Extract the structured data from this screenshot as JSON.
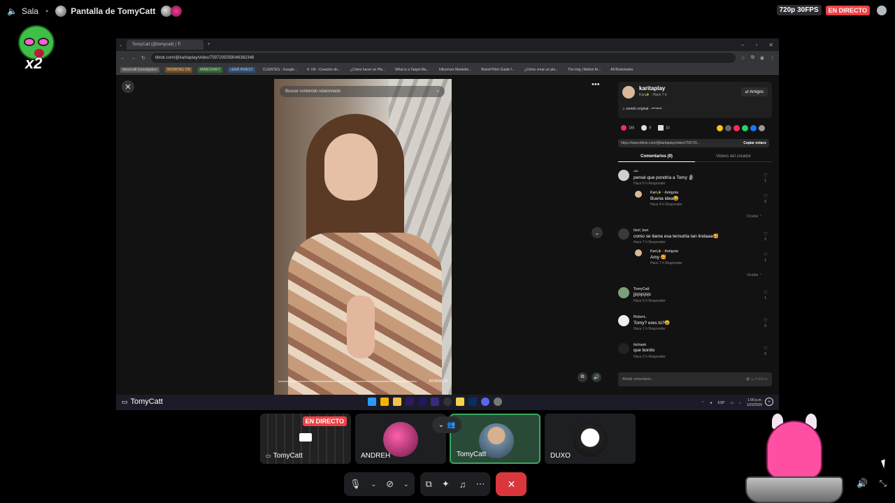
{
  "topbar": {
    "channel_label": "Sala",
    "stream_title": "Pantalla de TomyCatt",
    "quality": "720p 30FPS",
    "live_badge": "EN DIRECTO"
  },
  "mascot": {
    "multiplier": "x2"
  },
  "browser": {
    "tab_title": "TomyCatt (@tomycatt) | Ti",
    "url": "tiktok.com/@karitaplay/video/7597205059046362348",
    "bookmarks": [
      {
        "label": "minecraft investigation",
        "color": "#5a5a5a"
      },
      {
        "label": "WORKING ON",
        "color": "#7a4d1c"
      },
      {
        "label": "MINECRAFT",
        "color": "#2e6b2f"
      },
      {
        "label": "LEER INVEST",
        "color": "#2b4f7a"
      },
      {
        "label": "CLIENTES - Google..."
      },
      {
        "label": "4. I.M - Creación de..."
      },
      {
        "label": "¿Cómo hacer un Pla..."
      },
      {
        "label": "What is a Target Ma..."
      },
      {
        "label": "Influencer Marketin..."
      },
      {
        "label": "Brand Pitch Guide f..."
      },
      {
        "label": "¿Cómo crear un pla..."
      },
      {
        "label": "The img | Motion Ar..."
      },
      {
        "label": "All Bookmarks"
      }
    ]
  },
  "video": {
    "search_placeholder": "Buscar contenido relacionado",
    "time": "00:00/00:33"
  },
  "panel": {
    "username": "karitaplay",
    "user_meta": "Kari✨ · Hace 7 h",
    "friends_button": "⇄ Amigos",
    "sound": "♫ sonido original - ᵏᵃʳⁱᵗᵃᵖˡᵃʸ",
    "likes": "165",
    "comments_count": "9",
    "saves": "10",
    "link": "https://www.tiktok.com/@karitaplay/video/759720...",
    "copy_link": "Copiar enlace",
    "tab_comments": "Comentarios (9)",
    "tab_creator": "Videos del creador",
    "hide_label": "Ocultar ⌃",
    "add_comment_placeholder": "Añadir comentario...",
    "publish": "Publicar",
    "comments": [
      {
        "name": "ᵃᵈⁱᵃ",
        "text": "pensé que pondría a Tomy 🗿",
        "meta": "Hace 6 h    Responder",
        "likes": "1",
        "reply": false
      },
      {
        "name": "Kari✨ · Amigo/a",
        "text": "Buena idea😆",
        "meta": "Hace 4 h    Responder",
        "likes": "0",
        "reply": true
      },
      {
        "name": "itzel_kun",
        "text": "como se llama esa ternurita tan lindaaa🥰",
        "meta": "Hace 7 h    Responder",
        "likes": "2",
        "reply": false
      },
      {
        "name": "Kari✨ · Amigo/a",
        "text": "Amy 🥰",
        "meta": "Hace 7 h    Responder",
        "likes": "1",
        "reply": true
      },
      {
        "name": "TomyCatt",
        "text": "jjsjsjsjsjs",
        "meta": "Hace 5 h    Responder",
        "likes": "1",
        "reply": false
      },
      {
        "name": "Robert..",
        "text": "Tomy? eres tú?😆",
        "meta": "Hace 1 h    Responder",
        "likes": "0",
        "reply": false
      },
      {
        "name": "itsfrank",
        "text": "que bonito",
        "meta": "Hace 2 h    Responder",
        "likes": "0",
        "reply": false
      }
    ]
  },
  "taskbar": {
    "presenter": "TomyCatt",
    "lang": "ESP",
    "clock": "1:06 p.m.",
    "date": "1/20/2026"
  },
  "participants": [
    {
      "name": "TomyCatt",
      "live": "EN DIRECTO",
      "streaming": true
    },
    {
      "name": "ANDREH"
    },
    {
      "name": "TomyCatt",
      "selected": true
    },
    {
      "name": "DUXO"
    }
  ]
}
